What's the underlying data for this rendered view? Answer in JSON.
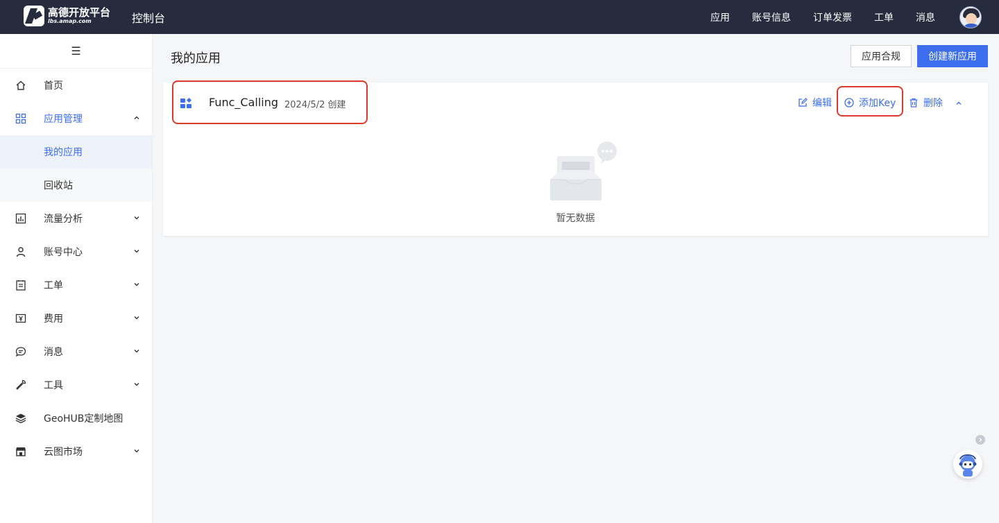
{
  "topbar": {
    "logo_main": "高德开放平台",
    "logo_sub": "lbs.amap.com",
    "console_title": "控制台",
    "nav": [
      "应用",
      "账号信息",
      "订单发票",
      "工单",
      "消息"
    ]
  },
  "sidebar": {
    "items": [
      {
        "label": "首页",
        "icon": "home-icon"
      },
      {
        "label": "应用管理",
        "icon": "grid-icon",
        "expanded": true
      },
      {
        "label": "流量分析",
        "icon": "chart-icon"
      },
      {
        "label": "账号中心",
        "icon": "user-icon"
      },
      {
        "label": "工单",
        "icon": "ticket-icon"
      },
      {
        "label": "费用",
        "icon": "yen-icon"
      },
      {
        "label": "消息",
        "icon": "message-icon"
      },
      {
        "label": "工具",
        "icon": "wrench-icon"
      },
      {
        "label": "GeoHUB定制地图",
        "icon": "layers-icon"
      },
      {
        "label": "云图市场",
        "icon": "store-icon"
      }
    ],
    "submenu": [
      {
        "label": "我的应用",
        "selected": true
      },
      {
        "label": "回收站",
        "selected": false
      }
    ]
  },
  "main": {
    "page_title": "我的应用",
    "btn_compliance": "应用合规",
    "btn_create": "创建新应用",
    "app": {
      "name": "Func_Calling",
      "created": "2024/5/2 创建",
      "actions": {
        "edit": "编辑",
        "add_key": "添加Key",
        "delete": "删除"
      },
      "empty_text": "暂无数据"
    }
  },
  "colors": {
    "topbar_bg": "#262b3e",
    "accent": "#3d6ef0",
    "annotation": "#dc3b2c"
  }
}
